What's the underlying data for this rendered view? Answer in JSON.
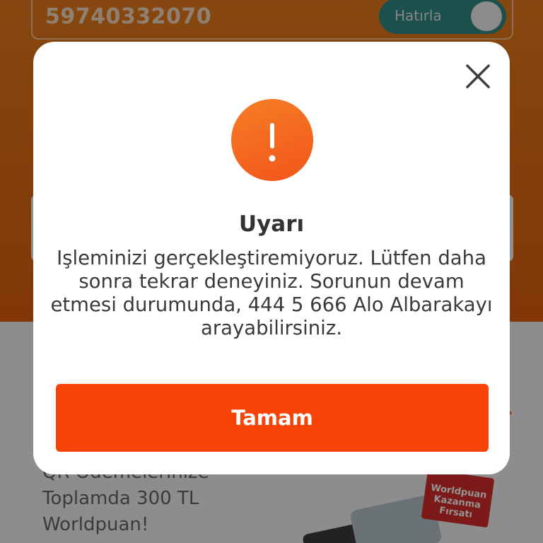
{
  "background": {
    "customer_number": "59740332070",
    "remember_label": "Hatırla",
    "promo_lines": [
      "QR Ödemelerinize",
      "Toplamda 300 TL",
      "Worldpuan!"
    ],
    "promo_badge": "Worldpuan Kazanma Fırsatı"
  },
  "dialog": {
    "title": "Uyarı",
    "message": "Işleminizi gerçekleştiremiyoruz. Lütfen daha sonra tekrar deneyiniz. Sorunun devam etmesi durumunda, 444 5 666 Alo Albarakayı arayabilirsiniz.",
    "ok_label": "Tamam",
    "icon": "exclamation-icon",
    "close_icon": "close-icon"
  },
  "colors": {
    "accent": "#f84307",
    "icon_gradient_start": "#f57e26",
    "icon_gradient_end": "#f3541a",
    "header_orange": "#e26a12",
    "toggle_teal": "#2f8a85"
  }
}
